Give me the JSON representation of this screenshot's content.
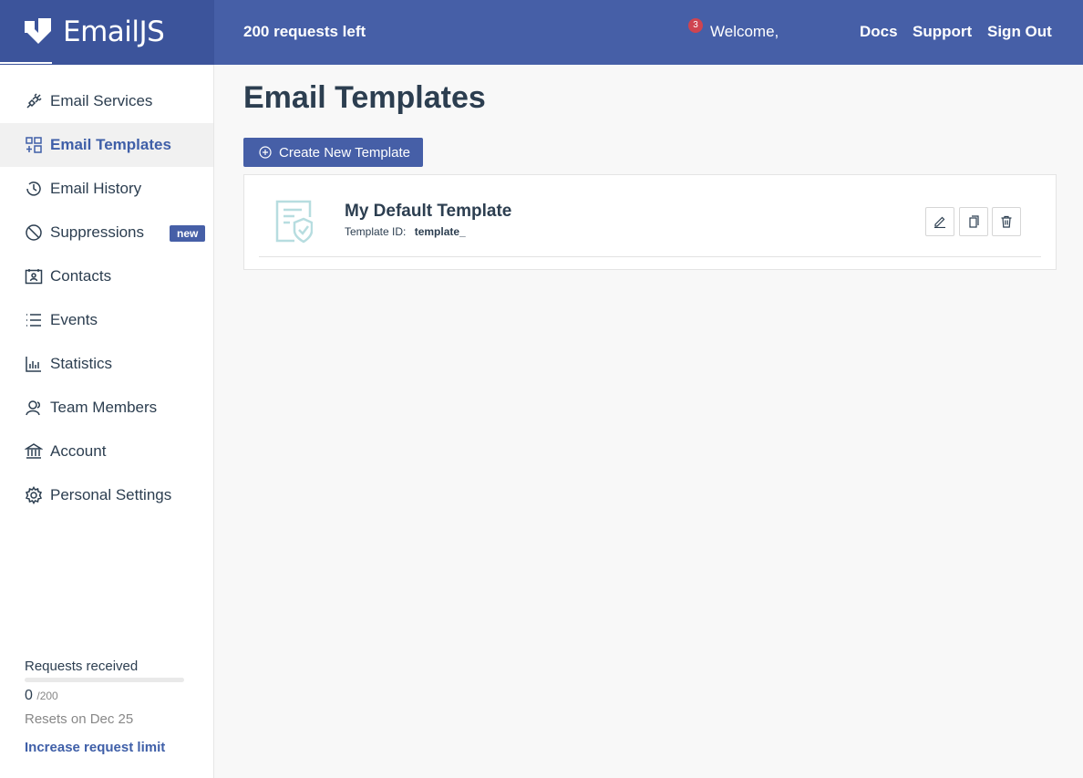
{
  "brand": {
    "name": "EmailJS"
  },
  "header": {
    "requests_left": "200 requests left",
    "notification_count": "3",
    "welcome": "Welcome,",
    "links": {
      "docs": "Docs",
      "support": "Support",
      "signout": "Sign Out"
    }
  },
  "sidebar": {
    "items": [
      {
        "label": "Email Services",
        "icon": "plug-icon"
      },
      {
        "label": "Email Templates",
        "icon": "templates-grid-icon",
        "active": true
      },
      {
        "label": "Email History",
        "icon": "history-clock-icon"
      },
      {
        "label": "Suppressions",
        "icon": "ban-icon",
        "badge": "new"
      },
      {
        "label": "Contacts",
        "icon": "contact-card-icon"
      },
      {
        "label": "Events",
        "icon": "list-icon"
      },
      {
        "label": "Statistics",
        "icon": "bar-chart-icon"
      },
      {
        "label": "Team Members",
        "icon": "team-icon"
      },
      {
        "label": "Account",
        "icon": "bank-icon"
      },
      {
        "label": "Personal Settings",
        "icon": "gear-icon"
      }
    ],
    "usage": {
      "label": "Requests received",
      "count": "0",
      "total": "/200",
      "fraction": 0,
      "resets": "Resets on Dec 25",
      "increase_link": "Increase request limit"
    }
  },
  "main": {
    "title": "Email Templates",
    "create_button": "Create New Template",
    "templates": [
      {
        "name": "My Default Template",
        "id_label": "Template ID:",
        "id_value": "template_"
      }
    ]
  },
  "colors": {
    "accent": "#465fa7",
    "brand_dark": "#3c549b",
    "badge_red": "#cf4450",
    "text": "#2c3e50"
  }
}
